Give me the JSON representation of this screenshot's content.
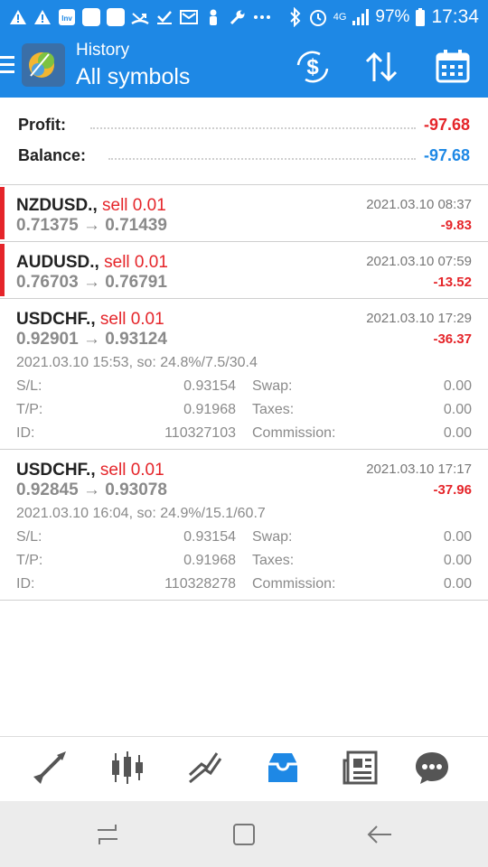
{
  "status_bar": {
    "battery": "97%",
    "time": "17:34",
    "network": "4G"
  },
  "header": {
    "title": "History",
    "subtitle": "All symbols"
  },
  "summary": {
    "profit_label": "Profit:",
    "profit_value": "-97.68",
    "balance_label": "Balance:",
    "balance_value": "-97.68"
  },
  "trades": [
    {
      "symbol": "NZDUSD.,",
      "side": "sell 0.01",
      "time": "2021.03.10 08:37",
      "prices": "0.71375 → 0.71439",
      "profit": "-9.83"
    },
    {
      "symbol": "AUDUSD.,",
      "side": "sell 0.01",
      "time": "2021.03.10 07:59",
      "prices": "0.76703 → 0.76791",
      "profit": "-13.52"
    },
    {
      "symbol": "USDCHF.,",
      "side": "sell 0.01",
      "time": "2021.03.10 17:29",
      "prices": "0.92901 → 0.93124",
      "profit": "-36.37",
      "open_info": "2021.03.10 15:53, so: 24.8%/7.5/30.4",
      "sl_label": "S/L:",
      "sl": "0.93154",
      "swap_label": "Swap:",
      "swap": "0.00",
      "tp_label": "T/P:",
      "tp": "0.91968",
      "taxes_label": "Taxes:",
      "taxes": "0.00",
      "id_label": "ID:",
      "id": "110327103",
      "commission_label": "Commission:",
      "commission": "0.00"
    },
    {
      "symbol": "USDCHF.,",
      "side": "sell 0.01",
      "time": "2021.03.10 17:17",
      "prices": "0.92845 → 0.93078",
      "profit": "-37.96",
      "open_info": "2021.03.10 16:04, so: 24.9%/15.1/60.7",
      "sl_label": "S/L:",
      "sl": "0.93154",
      "swap_label": "Swap:",
      "swap": "0.00",
      "tp_label": "T/P:",
      "tp": "0.91968",
      "taxes_label": "Taxes:",
      "taxes": "0.00",
      "id_label": "ID:",
      "id": "110328278",
      "commission_label": "Commission:",
      "commission": "0.00"
    }
  ],
  "bottom_nav": [
    {
      "icon": "quotes-icon"
    },
    {
      "icon": "chart-icon"
    },
    {
      "icon": "trade-icon"
    },
    {
      "icon": "history-icon",
      "active": true
    },
    {
      "icon": "news-icon"
    },
    {
      "icon": "chat-icon"
    }
  ],
  "colors": {
    "primary": "#1e88e5",
    "loss": "#e5252a",
    "balance": "#1e88e5",
    "muted": "#8a8a8a"
  }
}
